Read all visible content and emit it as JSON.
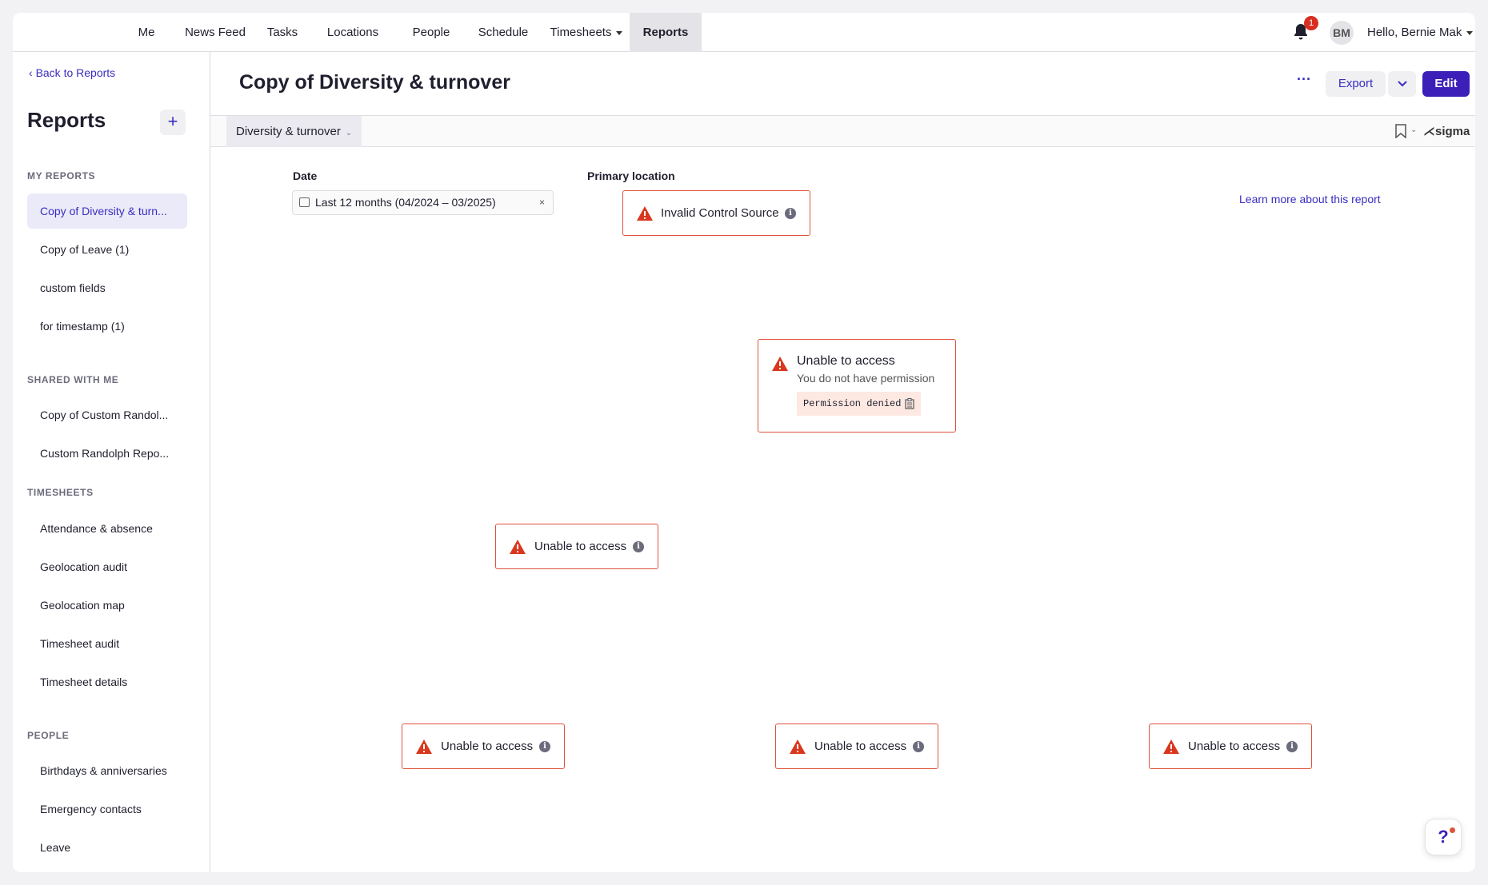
{
  "nav": {
    "items": [
      "Me",
      "News Feed",
      "Tasks",
      "Locations",
      "People",
      "Schedule",
      "Timesheets",
      "Reports"
    ],
    "active": "Reports",
    "notification_count": "1",
    "avatar_initials": "BM",
    "greeting": "Hello, Bernie Mak"
  },
  "sidebar": {
    "back_label": "Back to Reports",
    "title": "Reports",
    "add_label": "+",
    "sections": [
      {
        "title": "MY REPORTS",
        "items": [
          "Copy of Diversity & turn...",
          "Copy of Leave (1)",
          "custom fields",
          "for timestamp (1)"
        ]
      },
      {
        "title": "SHARED WITH ME",
        "items": [
          "Copy of Custom Randol...",
          "Custom Randolph Repo..."
        ]
      },
      {
        "title": "TIMESHEETS",
        "items": [
          "Attendance & absence",
          "Geolocation audit",
          "Geolocation map",
          "Timesheet audit",
          "Timesheet details"
        ]
      },
      {
        "title": "PEOPLE",
        "items": [
          "Birthdays & anniversaries",
          "Emergency contacts",
          "Leave"
        ]
      }
    ]
  },
  "main": {
    "title": "Copy of Diversity & turnover",
    "more_label": "···",
    "export_label": "Export",
    "edit_label": "Edit",
    "tab_label": "Diversity & turnover",
    "sigma_label": "sigma",
    "date_label": "Date",
    "date_value": "Last 12 months (04/2024 – 03/2025)",
    "clear_label": "×",
    "location_label": "Primary location",
    "learn_more": "Learn more about this report",
    "errors": {
      "invalid_control": "Invalid Control Source",
      "unable": "Unable to access",
      "no_permission": "You do not have permission",
      "permission_denied": "Permission denied"
    },
    "help_label": "?"
  },
  "colors": {
    "accent": "#3b1fb8",
    "link": "#3b2dbf",
    "error_border": "#e0523b",
    "warning_icon": "#d9381e"
  }
}
